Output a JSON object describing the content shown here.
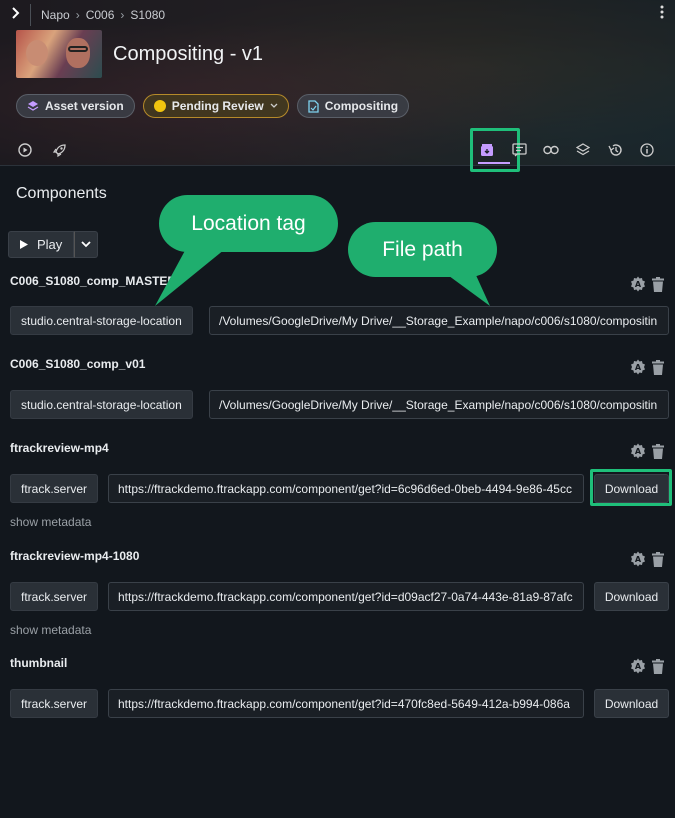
{
  "breadcrumb": [
    "Napo",
    "C006",
    "S1080"
  ],
  "title": "Compositing - v1",
  "chips": {
    "asset_version": "Asset version",
    "status": "Pending Review",
    "task": "Compositing"
  },
  "colors": {
    "accent_green": "#1fae6e",
    "status_yellow": "#f1c40f",
    "active_tab": "#c59cff"
  },
  "section_title": "Components",
  "play_label": "Play",
  "callouts": {
    "location_tag": "Location tag",
    "file_path": "File path"
  },
  "components": [
    {
      "name": "C006_S1080_comp_MASTER",
      "location": "studio.central-storage-location",
      "path": "/Volumes/GoogleDrive/My Drive/__Storage_Example/napo/c006/s1080/compositin"
    },
    {
      "name": "C006_S1080_comp_v01",
      "location": "studio.central-storage-location",
      "path": "/Volumes/GoogleDrive/My Drive/__Storage_Example/napo/c006/s1080/compositin"
    },
    {
      "name": "ftrackreview-mp4",
      "location": "ftrack.server",
      "path": "https://ftrackdemo.ftrackapp.com/component/get?id=6c96d6ed-0beb-4494-9e86-45cc",
      "download": "Download",
      "meta": "show metadata"
    },
    {
      "name": "ftrackreview-mp4-1080",
      "location": "ftrack.server",
      "path": "https://ftrackdemo.ftrackapp.com/component/get?id=d09acf27-0a74-443e-81a9-87afc",
      "download": "Download",
      "meta": "show metadata"
    },
    {
      "name": "thumbnail",
      "location": "ftrack.server",
      "path": "https://ftrackdemo.ftrackapp.com/component/get?id=470fc8ed-5649-412a-b994-086a",
      "download": "Download"
    }
  ]
}
